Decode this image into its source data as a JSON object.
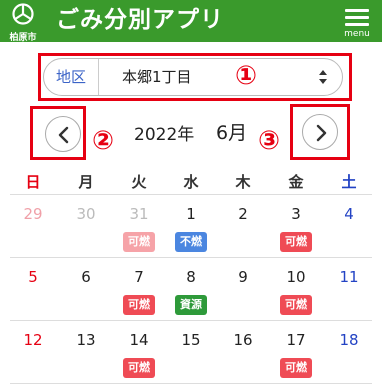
{
  "header": {
    "logo_text": "柏原市",
    "title": "ごみ分別アプリ",
    "menu_label": "menu",
    "color": "#3a9a2c"
  },
  "region": {
    "label": "地区",
    "value": "本郷1丁目"
  },
  "markers": [
    "①",
    "②",
    "③"
  ],
  "nav": {
    "year": "2022年",
    "month": "6月"
  },
  "weekdays": [
    "日",
    "月",
    "火",
    "水",
    "木",
    "金",
    "土"
  ],
  "weeks": [
    {
      "dates": [
        "29",
        "30",
        "31",
        "1",
        "2",
        "3",
        "4"
      ],
      "badges": [
        {
          "day": 2,
          "text": "可燃",
          "color": "#f6a3a8"
        },
        {
          "day": 3,
          "text": "不燃",
          "color": "#4b86e0"
        },
        {
          "day": 5,
          "text": "可燃",
          "color": "#ef4b55"
        }
      ]
    },
    {
      "dates": [
        "5",
        "6",
        "7",
        "8",
        "9",
        "10",
        "11"
      ],
      "badges": [
        {
          "day": 2,
          "text": "可燃",
          "color": "#ef4b55"
        },
        {
          "day": 3,
          "text": "資源",
          "color": "#2e9a3a"
        },
        {
          "day": 5,
          "text": "可燃",
          "color": "#ef4b55"
        }
      ]
    },
    {
      "dates": [
        "12",
        "13",
        "14",
        "15",
        "16",
        "17",
        "18"
      ],
      "badges": [
        {
          "day": 2,
          "text": "可燃",
          "color": "#ef4b55"
        },
        {
          "day": 5,
          "text": "可燃",
          "color": "#ef4b55"
        }
      ]
    }
  ],
  "colors": {
    "sunday": "#e60012",
    "saturday": "#2343c4",
    "prev_month": "#bbbbbb",
    "prev_month_sunday": "#f0a0a8",
    "highlight": "#e60012"
  }
}
